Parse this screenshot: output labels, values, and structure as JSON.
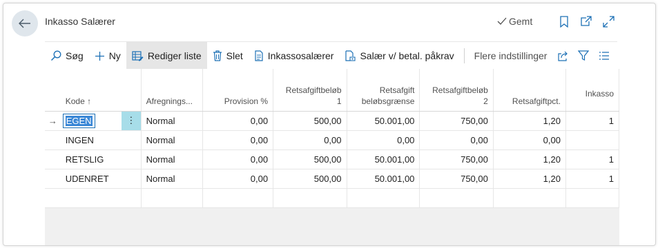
{
  "header": {
    "title": "Inkasso Salærer",
    "saved_label": "Gemt"
  },
  "toolbar": {
    "search": "Søg",
    "new": "Ny",
    "edit_list": "Rediger liste",
    "delete": "Slet",
    "inkasso_fees": "Inkassosalærer",
    "fees_with_reminder": "Salær v/ betal. påkrav",
    "more_options": "Flere indstillinger"
  },
  "grid": {
    "columns": {
      "kode": "Kode",
      "sort_indicator": "↑",
      "afregning": "Afregnings...",
      "provision": "Provision %",
      "retsafgift1_l1": "Retsafgiftbeløb",
      "retsafgift1_l2": "1",
      "graense_l1": "Retsafgift",
      "graense_l2": "beløbsgrænse",
      "retsafgift2_l1": "Retsafgiftbeløb",
      "retsafgift2_l2": "2",
      "pct": "Retsafgiftpct.",
      "inkasso": "Inkasso"
    },
    "rows": [
      {
        "kode": "EGEN",
        "afregning": "Normal",
        "provision": "0,00",
        "retsafgift1": "500,00",
        "graense": "50.001,00",
        "retsafgift2": "750,00",
        "pct": "1,20",
        "inkasso": "1"
      },
      {
        "kode": "INGEN",
        "afregning": "Normal",
        "provision": "0,00",
        "retsafgift1": "0,00",
        "graense": "0,00",
        "retsafgift2": "0,00",
        "pct": "0,00",
        "inkasso": ""
      },
      {
        "kode": "RETSLIG",
        "afregning": "Normal",
        "provision": "0,00",
        "retsafgift1": "500,00",
        "graense": "50.001,00",
        "retsafgift2": "750,00",
        "pct": "1,20",
        "inkasso": "1"
      },
      {
        "kode": "UDENRET",
        "afregning": "Normal",
        "provision": "0,00",
        "retsafgift1": "500,00",
        "graense": "50.001,00",
        "retsafgift2": "750,00",
        "pct": "1,20",
        "inkasso": "1"
      }
    ],
    "current_row_marker": "→",
    "row_menu_glyph": "⋮"
  },
  "colors": {
    "accent": "#1b6fb5",
    "selection": "#3a87d6",
    "row_menu_bg": "#a7dde9",
    "back_button_bg": "#dfe6ec"
  }
}
